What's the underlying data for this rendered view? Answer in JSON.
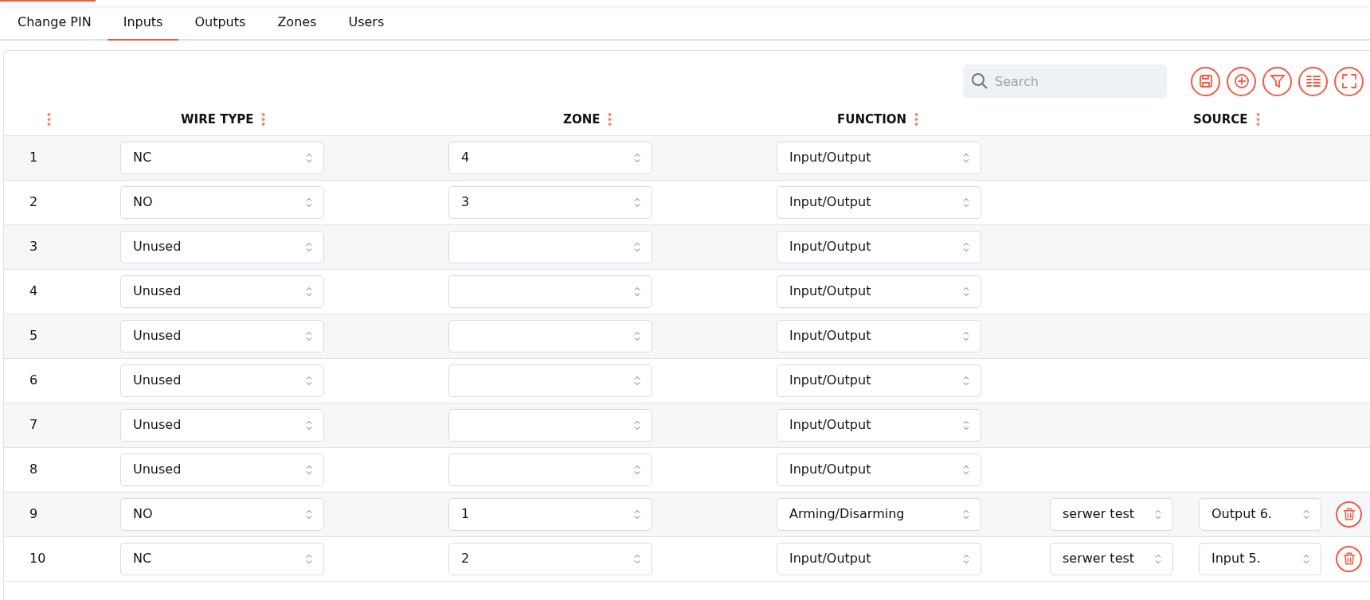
{
  "loading_bar": {
    "level": 0.07
  },
  "tabs": [
    {
      "label": "Change PIN",
      "selected": false
    },
    {
      "label": "Inputs",
      "selected": true
    },
    {
      "label": "Outputs",
      "selected": false
    },
    {
      "label": "Zones",
      "selected": false
    },
    {
      "label": "Users",
      "selected": false
    }
  ],
  "search": {
    "placeholder": "Search"
  },
  "table": {
    "columns": [
      "WIRE TYPE",
      "ZONE",
      "FUNCTION",
      "SOURCE"
    ],
    "rows": [
      {
        "number": "1",
        "wire_type": "NC",
        "zone": "4",
        "function": "Input/Output"
      },
      {
        "number": "2",
        "wire_type": "NO",
        "zone": "3",
        "function": "Input/Output"
      },
      {
        "number": "3",
        "wire_type": "Unused",
        "function": "Input/Output"
      },
      {
        "number": "4",
        "wire_type": "Unused",
        "function": "Input/Output"
      },
      {
        "number": "5",
        "wire_type": "Unused",
        "function": "Input/Output"
      },
      {
        "number": "6",
        "wire_type": "Unused",
        "function": "Input/Output"
      },
      {
        "number": "7",
        "wire_type": "Unused",
        "function": "Input/Output"
      },
      {
        "number": "8",
        "wire_type": "Unused",
        "function": "Input/Output"
      },
      {
        "number": "9",
        "wire_type": "NO",
        "zone": "1",
        "function": "Arming/Disarming",
        "source": {
          "device": "serwer test",
          "channel": "Output 6."
        }
      },
      {
        "number": "10",
        "wire_type": "NC",
        "zone": "2",
        "function": "Input/Output",
        "source": {
          "device": "serwer test",
          "channel": "Input 5."
        }
      }
    ]
  }
}
